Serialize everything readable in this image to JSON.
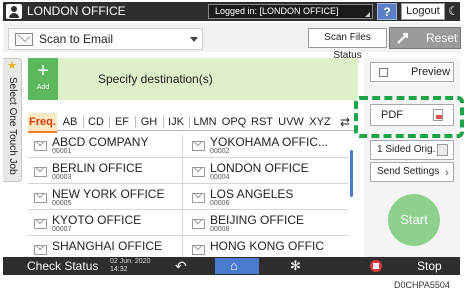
{
  "header": {
    "office_title": "LONDON OFFICE",
    "login_status": "Logged in: [LONDON OFFICE]",
    "help_label": "?",
    "logout_label": "Logout"
  },
  "mode": {
    "selected": "Scan to Email",
    "scan_files_status_label": "Scan Files Status",
    "reset_label": "Reset"
  },
  "side_tab": {
    "label": "Select One Touch Job"
  },
  "destination": {
    "add_label": "Add",
    "specify_label": "Specify destination(s)",
    "index_tabs": [
      "Freq.",
      "AB",
      "CD",
      "EF",
      "GH",
      "IJK",
      "LMN",
      "OPQ",
      "RST",
      "UVW",
      "XYZ"
    ],
    "selected_index": "Freq.",
    "entries": [
      {
        "name": "ABCD COMPANY",
        "number": "00001"
      },
      {
        "name": "YOKOHAMA OFFIC...",
        "number": "00002"
      },
      {
        "name": "BERLIN OFFICE",
        "number": "00003"
      },
      {
        "name": "LONDON OFFICE",
        "number": "00004"
      },
      {
        "name": "NEW YORK OFFICE",
        "number": "00005"
      },
      {
        "name": "LOS ANGELES",
        "number": "00006"
      },
      {
        "name": "KYOTO OFFICE",
        "number": "00007"
      },
      {
        "name": "BEIJING OFFICE",
        "number": "00008"
      },
      {
        "name": "SHANGHAI OFFICE",
        "number": ""
      },
      {
        "name": "HONG KONG OFFIC",
        "number": ""
      }
    ]
  },
  "right_panel": {
    "preview_label": "Preview",
    "file_type_label": "PDF",
    "sided_label": "1 Sided Orig.",
    "send_settings_label": "Send Settings",
    "start_label": "Start"
  },
  "footer": {
    "check_status_label": "Check Status",
    "date": "02 Jun. 2020",
    "time": "14:32",
    "stop_label": "Stop"
  },
  "caption": "D0CHPA5504",
  "colors": {
    "topbar": "#2e2e2e",
    "add_button": "#5cb85c",
    "specify_bar": "#dff0c8",
    "highlight": "#1fa349",
    "start_button": "#8ed18e",
    "home_button": "#4b7bd1"
  }
}
